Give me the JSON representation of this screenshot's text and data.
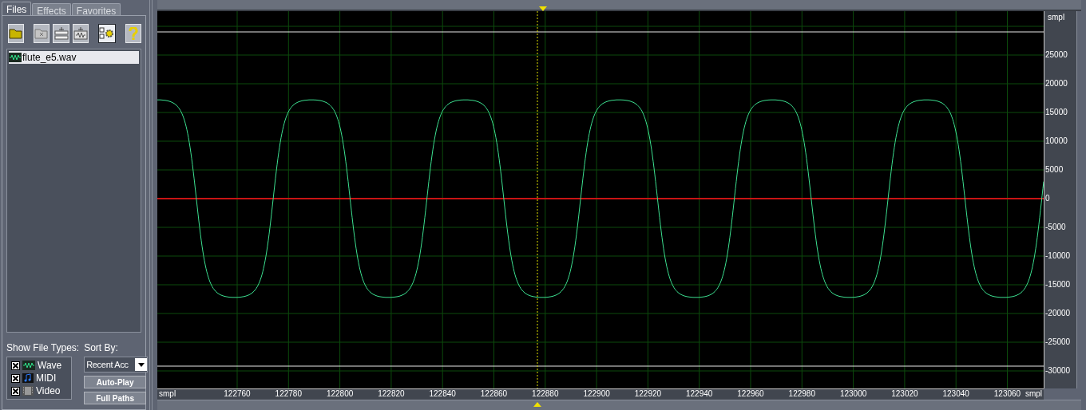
{
  "tabs": [
    {
      "label": "Files",
      "selected": true
    },
    {
      "label": "Effects",
      "selected": false
    },
    {
      "label": "Favorites",
      "selected": false
    }
  ],
  "toolbar": [
    {
      "kind": "open",
      "pressed": false
    },
    {
      "kind": "close",
      "pressed": false
    },
    {
      "kind": "insert",
      "pressed": false
    },
    {
      "kind": "mix",
      "pressed": false
    },
    {
      "kind": "options",
      "pressed": true
    },
    {
      "kind": "help",
      "pressed": false
    }
  ],
  "files": [
    {
      "name": "flute_e5.wav",
      "selected": true
    }
  ],
  "show_file_types": {
    "label": "Show File Types:",
    "types": [
      {
        "kind": "wave",
        "label": "Wave",
        "checked": true
      },
      {
        "kind": "midi",
        "label": "MIDI",
        "checked": true
      },
      {
        "kind": "video",
        "label": "Video",
        "checked": true
      }
    ]
  },
  "sort_by": {
    "label": "Sort By:",
    "value": "Recent Acc"
  },
  "buttons": [
    "Auto-Play",
    "Full Paths"
  ],
  "waveform": {
    "y_unit": "smpl",
    "y_labels": [
      "25000",
      "20000",
      "15000",
      "10000",
      "5000",
      "0",
      "-5000",
      "-10000",
      "-15000",
      "-20000",
      "-25000",
      "-30000"
    ],
    "x_unit_left": "smpl",
    "x_labels": [
      "122760",
      "122780",
      "122800",
      "122820",
      "122840",
      "122860",
      "122880",
      "122900",
      "122920",
      "122940",
      "122960",
      "122980",
      "123000",
      "123020",
      "123040",
      "123060"
    ],
    "x_unit_right": "smpl"
  }
}
